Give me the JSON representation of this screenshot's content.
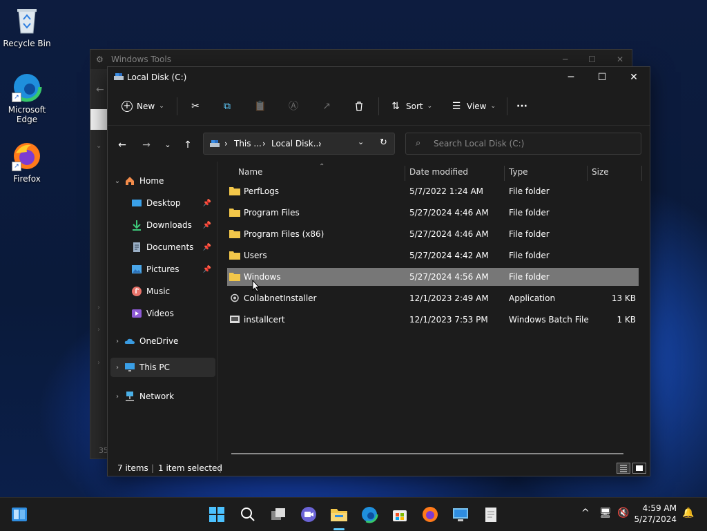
{
  "desktop": {
    "icons": [
      {
        "label": "Recycle Bin",
        "icon": "recycle-bin-icon"
      },
      {
        "label": "Microsoft Edge",
        "icon": "edge-icon"
      },
      {
        "label": "Firefox",
        "icon": "firefox-icon"
      }
    ]
  },
  "back_window": {
    "title": "Windows Tools",
    "status_fragment": "35"
  },
  "window": {
    "title": "Local Disk (C:)",
    "controls": {
      "minimize": "─",
      "maximize": "☐",
      "close": "✕"
    }
  },
  "toolbar": {
    "new_label": "New",
    "sort_label": "Sort",
    "view_label": "View",
    "more_label": "···"
  },
  "address": {
    "segments": [
      "This ...",
      "Local Disk..."
    ],
    "separator": "›"
  },
  "search": {
    "placeholder": "Search Local Disk (C:)"
  },
  "sidebar": {
    "items": [
      {
        "label": "Home",
        "icon": "home-icon",
        "expanded": true
      },
      {
        "label": "Desktop",
        "icon": "desktop-icon",
        "pinned": true
      },
      {
        "label": "Downloads",
        "icon": "downloads-icon",
        "pinned": true
      },
      {
        "label": "Documents",
        "icon": "documents-icon",
        "pinned": true
      },
      {
        "label": "Pictures",
        "icon": "pictures-icon",
        "pinned": true
      },
      {
        "label": "Music",
        "icon": "music-icon"
      },
      {
        "label": "Videos",
        "icon": "videos-icon"
      },
      {
        "label": "OneDrive",
        "icon": "onedrive-icon"
      },
      {
        "label": "This PC",
        "icon": "this-pc-icon",
        "selected": true
      },
      {
        "label": "Network",
        "icon": "network-icon"
      }
    ]
  },
  "columns": {
    "name": "Name",
    "date": "Date modified",
    "type": "Type",
    "size": "Size"
  },
  "files": [
    {
      "name": "PerfLogs",
      "date": "5/7/2022 1:24 AM",
      "type": "File folder",
      "size": "",
      "kind": "folder"
    },
    {
      "name": "Program Files",
      "date": "5/27/2024 4:46 AM",
      "type": "File folder",
      "size": "",
      "kind": "folder"
    },
    {
      "name": "Program Files (x86)",
      "date": "5/27/2024 4:46 AM",
      "type": "File folder",
      "size": "",
      "kind": "folder"
    },
    {
      "name": "Users",
      "date": "5/27/2024 4:42 AM",
      "type": "File folder",
      "size": "",
      "kind": "folder"
    },
    {
      "name": "Windows",
      "date": "5/27/2024 4:56 AM",
      "type": "File folder",
      "size": "",
      "kind": "folder",
      "selected": true
    },
    {
      "name": "CollabnetInstaller",
      "date": "12/1/2023 2:49 AM",
      "type": "Application",
      "size": "13 KB",
      "kind": "app"
    },
    {
      "name": "installcert",
      "date": "12/1/2023 7:53 PM",
      "type": "Windows Batch File",
      "size": "1 KB",
      "kind": "batch"
    }
  ],
  "status": {
    "items": "7 items",
    "selected": "1 item selected"
  },
  "taskbar": {
    "apps": [
      "start-icon",
      "search-icon",
      "task-view-icon",
      "teams-icon",
      "file-explorer-icon",
      "edge-icon",
      "store-icon",
      "firefox-icon",
      "remote-desktop-icon",
      "notepad-icon"
    ],
    "clock_time": "4:59 AM",
    "clock_date": "5/27/2024",
    "tray_chevron": "^"
  },
  "colors": {
    "accent": "#60cdff",
    "folder": "#f3c74a",
    "selection": "#777777"
  }
}
